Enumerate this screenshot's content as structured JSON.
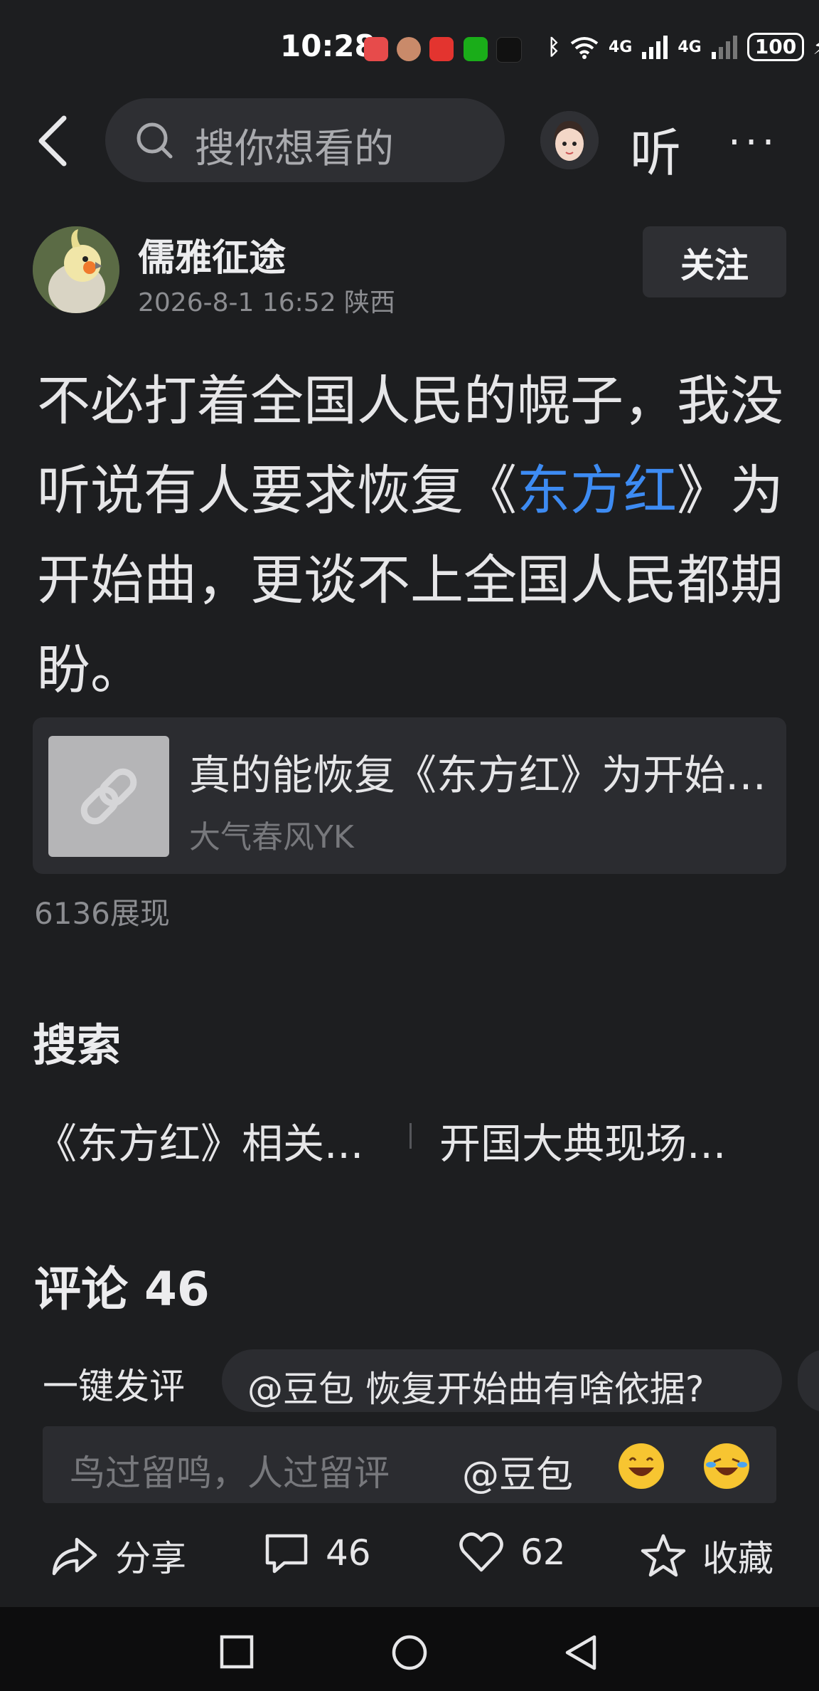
{
  "status_bar": {
    "time": "10:28",
    "network": "4G",
    "battery": "100"
  },
  "top_nav": {
    "search_placeholder": "搜你想看的",
    "listen_label": "听",
    "more_label": "···"
  },
  "author": {
    "name": "儒雅征途",
    "meta": "2026-8-1 16:52 陕西",
    "follow_label": "关注"
  },
  "post": {
    "body_before": "不必打着全国人民的幌子，我没听说有人要求恢复《",
    "body_link": "东方红",
    "body_after": "》为开始曲，更谈不上全国人民都期盼。",
    "link_card": {
      "title": "真的能恢复《东方红》为开始曲…",
      "source": "大气春风YK"
    },
    "views": "6136展现"
  },
  "search": {
    "heading": "搜索",
    "suggestions": [
      "《东方红》相关...",
      "开国大典现场..."
    ]
  },
  "comments": {
    "heading": "评论 46",
    "quick_label": "一键发评",
    "quick_chip": "@豆包 恢复开始曲有啥依据?",
    "input_placeholder": "鸟过留鸣，人过留评",
    "input_at": "@豆包"
  },
  "actions": {
    "share": "分享",
    "comment_count": "46",
    "like_count": "62",
    "favorite": "收藏"
  },
  "colors": {
    "background": "#1d1e20",
    "accent_link": "#3d8bf2"
  }
}
